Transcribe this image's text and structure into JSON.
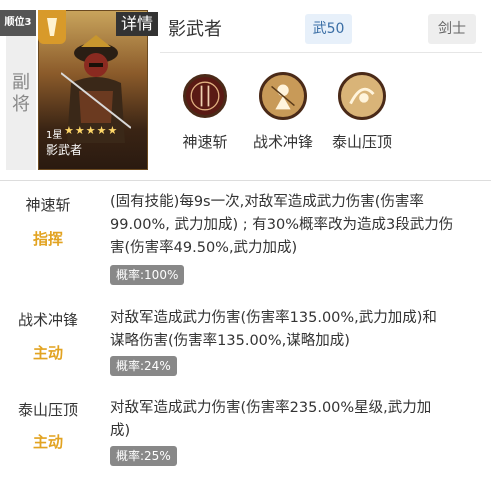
{
  "header": {
    "rank_badge": "顺位3",
    "vice_label": "副将",
    "detail_tag": "详情",
    "general_name": "影武者",
    "stat": "武50",
    "class": "剑士",
    "card": {
      "rank": "1星",
      "stars": "★★★★★",
      "name": "影武者"
    }
  },
  "skills": [
    {
      "name": "神速斩",
      "icon": "blade-icon"
    },
    {
      "name": "战术冲锋",
      "icon": "charge-icon"
    },
    {
      "name": "泰山压顶",
      "icon": "strike-icon"
    }
  ],
  "details": [
    {
      "name": "神速斩",
      "type": "指挥",
      "desc1": "(固有技能)每9s一次,对敌军造成武力伤害(伤害率",
      "desc2": "99.00%, 武力加成) ; 有30%概率改为造成3段武力伤",
      "desc3": "害(伤害率49.50%,武力加成)",
      "prob": "概率:100%"
    },
    {
      "name": "战术冲锋",
      "type": "主动",
      "desc1": "对敌军造成武力伤害(伤害率135.00%,武力加成)和",
      "desc2": "谋略伤害(伤害率135.00%,谋略加成)",
      "desc3": "",
      "prob": "概率:24%"
    },
    {
      "name": "泰山压顶",
      "type": "主动",
      "desc1": "对敌军造成武力伤害(伤害率235.00%星级,武力加",
      "desc2": "成)",
      "desc3": "",
      "prob": "概率:25%"
    }
  ],
  "colors": {
    "accent_orange": "#e2a321",
    "stat_blue": "#3a6ea5",
    "prob_gray": "#888888"
  }
}
